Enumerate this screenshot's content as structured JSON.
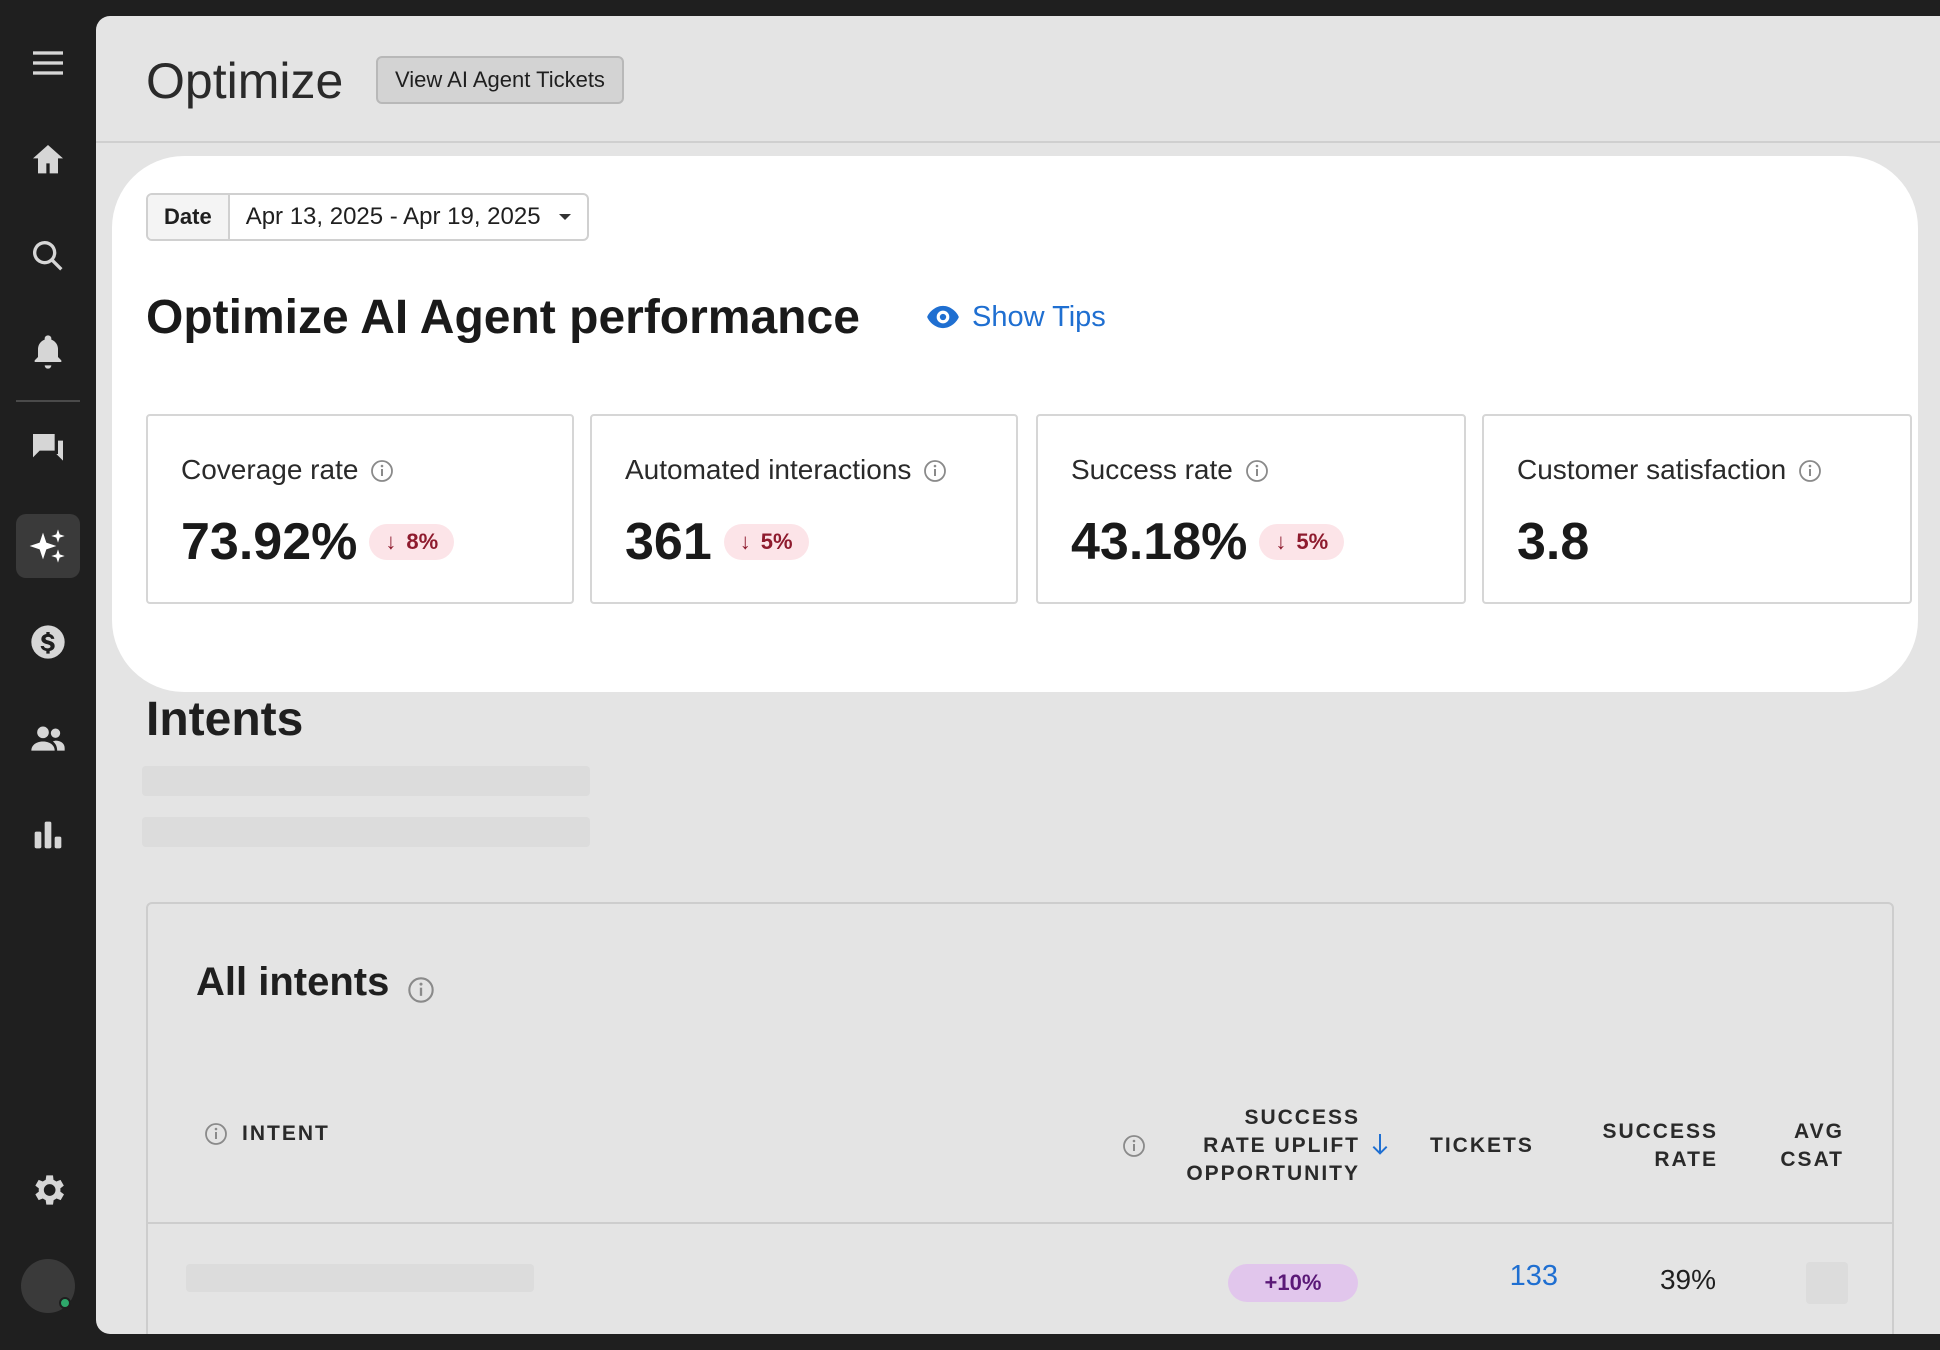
{
  "rail": {
    "icons": [
      "menu-icon",
      "home-icon",
      "search-icon",
      "bell-icon",
      "chat-icon",
      "sparkle-icon",
      "dollar-icon",
      "users-icon",
      "bar-chart-icon",
      "gear-icon"
    ]
  },
  "header": {
    "title": "Optimize",
    "view_tickets_label": "View AI Agent Tickets"
  },
  "filters": {
    "date_label": "Date",
    "date_value": "Apr 13, 2025 - Apr 19, 2025"
  },
  "performance": {
    "heading": "Optimize AI Agent performance",
    "show_tips_label": "Show Tips",
    "metrics": [
      {
        "label": "Coverage rate",
        "value": "73.92%",
        "delta": "8%",
        "delta_direction": "down"
      },
      {
        "label": "Automated interactions",
        "value": "361",
        "delta": "5%",
        "delta_direction": "down"
      },
      {
        "label": "Success rate",
        "value": "43.18%",
        "delta": "5%",
        "delta_direction": "down"
      },
      {
        "label": "Customer satisfaction",
        "value": "3.8"
      }
    ]
  },
  "intents": {
    "heading": "Intents",
    "all_intents_title": "All intents",
    "columns": {
      "intent": "INTENT",
      "uplift_line1": "SUCCESS",
      "uplift_line2": "RATE UPLIFT",
      "uplift_line3": "OPPORTUNITY",
      "tickets": "TICKETS",
      "success_line1": "SUCCESS",
      "success_line2": "RATE",
      "csat_line1": "AVG",
      "csat_line2": "CSAT"
    },
    "rows": [
      {
        "uplift": "+10%",
        "tickets": "133",
        "success_rate": "39%"
      }
    ]
  },
  "colors": {
    "accent": "#1f6fd1",
    "negative_badge_bg": "#fce4e8",
    "negative_badge_text": "#8e1b2e",
    "uplift_badge_bg": "#e1c6ec",
    "uplift_badge_text": "#5a1877"
  }
}
